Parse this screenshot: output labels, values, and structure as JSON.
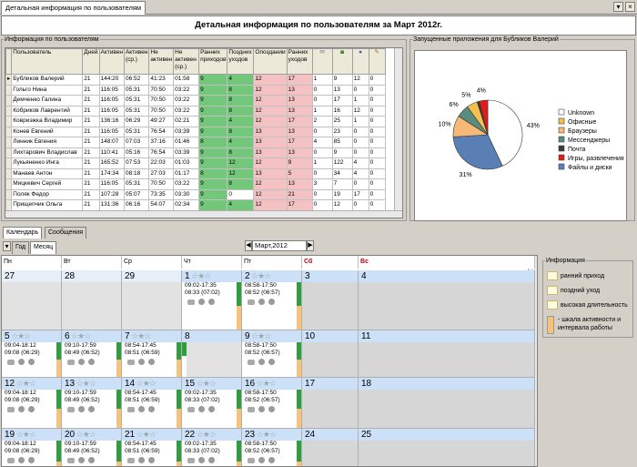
{
  "window_tab": "Детальная информация по пользователям",
  "header_title": "Детальная информация по пользователям  за Март 2012г.",
  "users_panel": {
    "legend": "Информация по пользователям",
    "columns": [
      "Пользователь",
      "Дней",
      "Активен",
      "Активен (ср.)",
      "Не активен",
      "Не активен (ср.)",
      "Ранних приходов",
      "Поздних уходов",
      "Опоздании",
      "Ранних уходов",
      "",
      "",
      "",
      ""
    ],
    "rows": [
      [
        "Бубликов Валерий",
        "21",
        "144:20",
        "06:52",
        "41:23",
        "01:58",
        "9",
        "4",
        "12",
        "17",
        "1",
        "9",
        "12",
        "0"
      ],
      [
        "Гольго Нина",
        "21",
        "116:05",
        "05:31",
        "70:50",
        "03:22",
        "9",
        "8",
        "12",
        "13",
        "0",
        "13",
        "0",
        "0"
      ],
      [
        "Демченко Галина",
        "21",
        "116:05",
        "05:31",
        "70:50",
        "03:22",
        "9",
        "8",
        "12",
        "13",
        "0",
        "17",
        "1",
        "0"
      ],
      [
        "Кобриков Лаврентий",
        "21",
        "116:05",
        "05:31",
        "70:50",
        "03:22",
        "9",
        "8",
        "12",
        "13",
        "1",
        "16",
        "12",
        "0"
      ],
      [
        "Ковриэжка Владимир",
        "21",
        "136:16",
        "06:29",
        "49:27",
        "02:21",
        "9",
        "4",
        "12",
        "17",
        "2",
        "25",
        "1",
        "0"
      ],
      [
        "Конев Евгений",
        "21",
        "116:05",
        "05:31",
        "76:54",
        "03:39",
        "9",
        "8",
        "13",
        "13",
        "0",
        "23",
        "0",
        "0"
      ],
      [
        "Линник Евгения",
        "21",
        "148:07",
        "07:03",
        "37:16",
        "01:46",
        "8",
        "4",
        "13",
        "17",
        "4",
        "85",
        "0",
        "0"
      ],
      [
        "Лихтарович Владислав",
        "21",
        "110:41",
        "05:16",
        "76:54",
        "03:39",
        "9",
        "8",
        "13",
        "13",
        "0",
        "9",
        "0",
        "0"
      ],
      [
        "Лукьяненко Инга",
        "21",
        "165:52",
        "07:53",
        "22:03",
        "01:03",
        "9",
        "12",
        "12",
        "9",
        "1",
        "122",
        "4",
        "0"
      ],
      [
        "Манаев Антон",
        "21",
        "174:34",
        "08:18",
        "27:03",
        "01:17",
        "8",
        "12",
        "13",
        "5",
        "0",
        "34",
        "4",
        "0"
      ],
      [
        "Мицкевич Сергей",
        "21",
        "116:05",
        "05:31",
        "70:50",
        "03:22",
        "9",
        "8",
        "12",
        "13",
        "3",
        "7",
        "0",
        "0"
      ],
      [
        "Поляк Федор",
        "21",
        "107:28",
        "05:07",
        "73:35",
        "03:30",
        "9",
        "0",
        "12",
        "21",
        "0",
        "19",
        "17",
        "0"
      ],
      [
        "Прищепчик Ольга",
        "21",
        "131:36",
        "06:16",
        "54:07",
        "02:34",
        "9",
        "4",
        "12",
        "17",
        "0",
        "12",
        "0",
        "0"
      ]
    ]
  },
  "apps_panel": {
    "legend": "Запущенные приложения для Бубликов Валерий",
    "pie_labels": {
      "unknown": "43%",
      "files": "31%",
      "browsers": "10%",
      "messengers": "6%",
      "office": "5%",
      "games": "4%"
    },
    "legend_items": [
      "Unknown",
      "Офисные",
      "Браузеры",
      "Мессенджеры",
      "Почта",
      "Игры, развлечения",
      "Файлы и диски"
    ],
    "colors": [
      "#ffffff",
      "#f5c04d",
      "#f7b977",
      "#5a8b7f",
      "#3c3c3c",
      "#e01c1c",
      "#5a7fb4"
    ]
  },
  "bottom_tabs": [
    "Календарь",
    "Сообщения"
  ],
  "view_tabs": [
    "Год",
    "Месяц"
  ],
  "month_label": "Март,2012",
  "weekdays": [
    "Пн",
    "Вт",
    "Ср",
    "Чт",
    "Пт",
    "Сб",
    "Вс"
  ],
  "calendar": {
    "w1": [
      {
        "d": "27",
        "l1": "",
        "l2": ""
      },
      {
        "d": "28",
        "l1": "",
        "l2": ""
      },
      {
        "d": "29",
        "l1": "",
        "l2": ""
      },
      {
        "d": "1",
        "l1": "09:02-17:35",
        "l2": "08:33 (07:02)"
      },
      {
        "d": "2",
        "l1": "08:58-17:50",
        "l2": "08:52 (06:57)"
      },
      {
        "d": "3",
        "l1": "",
        "l2": ""
      },
      {
        "d": "4",
        "l1": "",
        "l2": ""
      }
    ],
    "w2": [
      {
        "d": "5",
        "l1": "09:04-18:12",
        "l2": "09:08 (06:29)"
      },
      {
        "d": "6",
        "l1": "09:10-17:59",
        "l2": "08:49 (06:52)"
      },
      {
        "d": "7",
        "l1": "08:54-17:45",
        "l2": "08:51 (06:59)"
      },
      {
        "d": "8",
        "l1": "",
        "l2": ""
      },
      {
        "d": "9",
        "l1": "08:58-17:50",
        "l2": "08:52 (06:57)"
      },
      {
        "d": "10",
        "l1": "",
        "l2": ""
      },
      {
        "d": "11",
        "l1": "",
        "l2": ""
      }
    ],
    "w3": [
      {
        "d": "12",
        "l1": "09:04-18:12",
        "l2": "09:08 (06:29)"
      },
      {
        "d": "13",
        "l1": "09:10-17:59",
        "l2": "08:49 (06:52)"
      },
      {
        "d": "14",
        "l1": "08:54-17:45",
        "l2": "08:51 (06:59)"
      },
      {
        "d": "15",
        "l1": "09:02-17:35",
        "l2": "08:33 (07:02)"
      },
      {
        "d": "16",
        "l1": "08:58-17:50",
        "l2": "08:52 (06:57)"
      },
      {
        "d": "17",
        "l1": "",
        "l2": ""
      },
      {
        "d": "18",
        "l1": "",
        "l2": ""
      }
    ],
    "w4": [
      {
        "d": "19",
        "l1": "09:04-18:12",
        "l2": "09:08 (06:29)"
      },
      {
        "d": "20",
        "l1": "09:10-17:59",
        "l2": "08:49 (06:52)"
      },
      {
        "d": "21",
        "l1": "08:54-17:45",
        "l2": "08:51 (06:59)"
      },
      {
        "d": "22",
        "l1": "09:02-17:35",
        "l2": "08:33 (07:02)"
      },
      {
        "d": "23",
        "l1": "08:58-17:50",
        "l2": "08:52 (06:57)"
      },
      {
        "d": "24",
        "l1": "",
        "l2": ""
      },
      {
        "d": "25",
        "l1": "",
        "l2": ""
      }
    ]
  },
  "info_panel": {
    "legend": "Информация",
    "items": [
      "ранний приход",
      "поздний уход",
      "высокая длительность",
      "- шкала активности и интервала работы"
    ]
  }
}
